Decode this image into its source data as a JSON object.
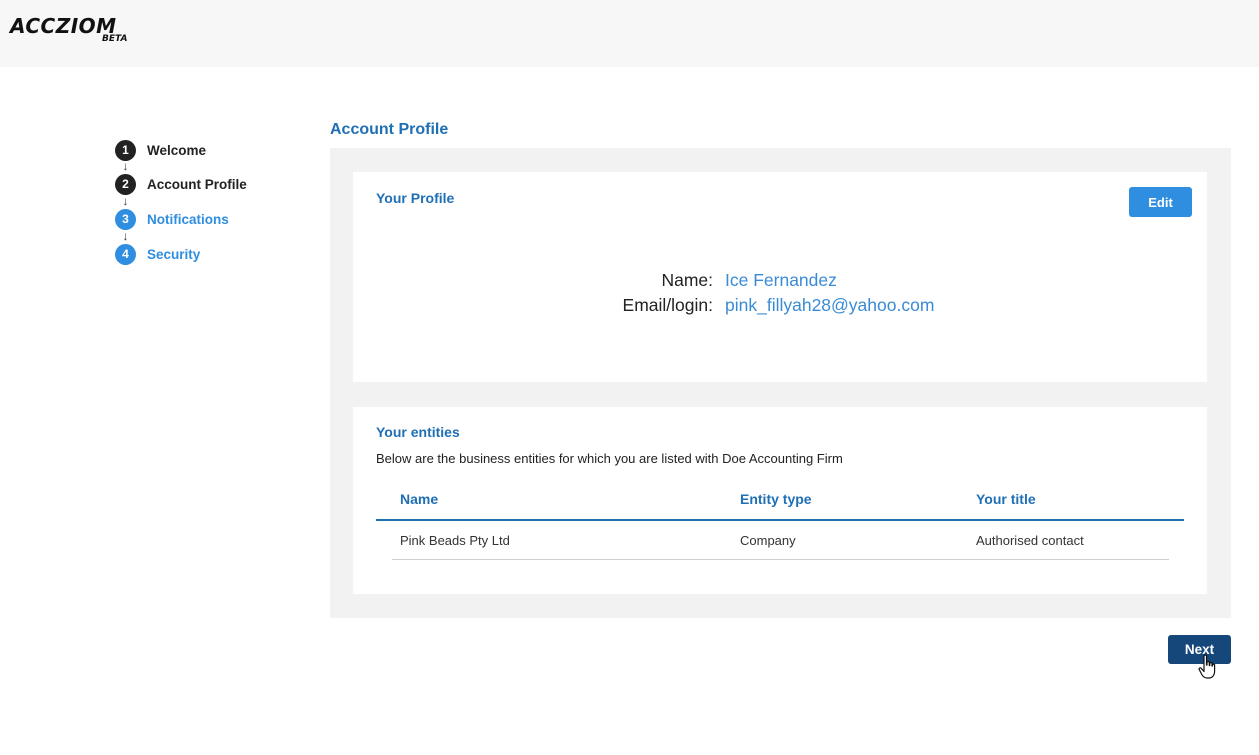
{
  "brand": {
    "name": "ACCZIOM",
    "tag": "BETA"
  },
  "stepper": {
    "steps": [
      {
        "number": "1",
        "label": "Welcome",
        "state": "done"
      },
      {
        "number": "2",
        "label": "Account Profile",
        "state": "done"
      },
      {
        "number": "3",
        "label": "Notifications",
        "state": "todo"
      },
      {
        "number": "4",
        "label": "Security",
        "state": "todo"
      }
    ],
    "arrow": "↓"
  },
  "page": {
    "title": "Account Profile"
  },
  "profile": {
    "heading": "Your Profile",
    "edit_label": "Edit",
    "name_label": "Name:",
    "name_value": "Ice Fernandez",
    "email_label": "Email/login:",
    "email_value": "pink_fillyah28@yahoo.com"
  },
  "entities": {
    "heading": "Your entities",
    "description": "Below are the business entities for which you are listed with Doe Accounting Firm",
    "columns": [
      "Name",
      "Entity type",
      "Your title"
    ],
    "rows": [
      [
        "Pink Beads Pty Ltd",
        "Company",
        "Authorised contact"
      ]
    ]
  },
  "footer": {
    "next_label": "Next"
  },
  "colors": {
    "accent": "#2f8ee0",
    "heading_blue": "#1f6fb5",
    "next_button": "#16477a",
    "panel_bg": "#f2f2f2"
  }
}
